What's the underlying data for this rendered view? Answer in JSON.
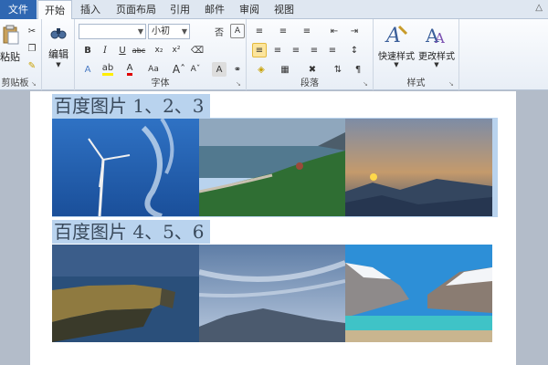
{
  "tabs": [
    "文件",
    "开始",
    "插入",
    "页面布局",
    "引用",
    "邮件",
    "审阅",
    "视图"
  ],
  "ribbon": {
    "clipboard": {
      "paste_label": "粘贴",
      "group_label": "剪贴板"
    },
    "font": {
      "group_label": "字体",
      "font_name_value": "",
      "font_size_value": "小初",
      "font_glyph_a": "A",
      "font_glyph_aa": "Aa"
    },
    "paragraph": {
      "group_label": "段落"
    },
    "editing": {
      "label": "编辑"
    },
    "styles": {
      "group_label": "样式",
      "quick_label": "快速样式",
      "change_label": "更改样式"
    }
  },
  "document": {
    "headings": [
      "百度图片 1、2、3",
      "百度图片 4、5、6"
    ]
  },
  "colors": {
    "selection": "#b9d3ee",
    "file_tab": "#2f67b2",
    "highlight_button": "#fce59c"
  }
}
